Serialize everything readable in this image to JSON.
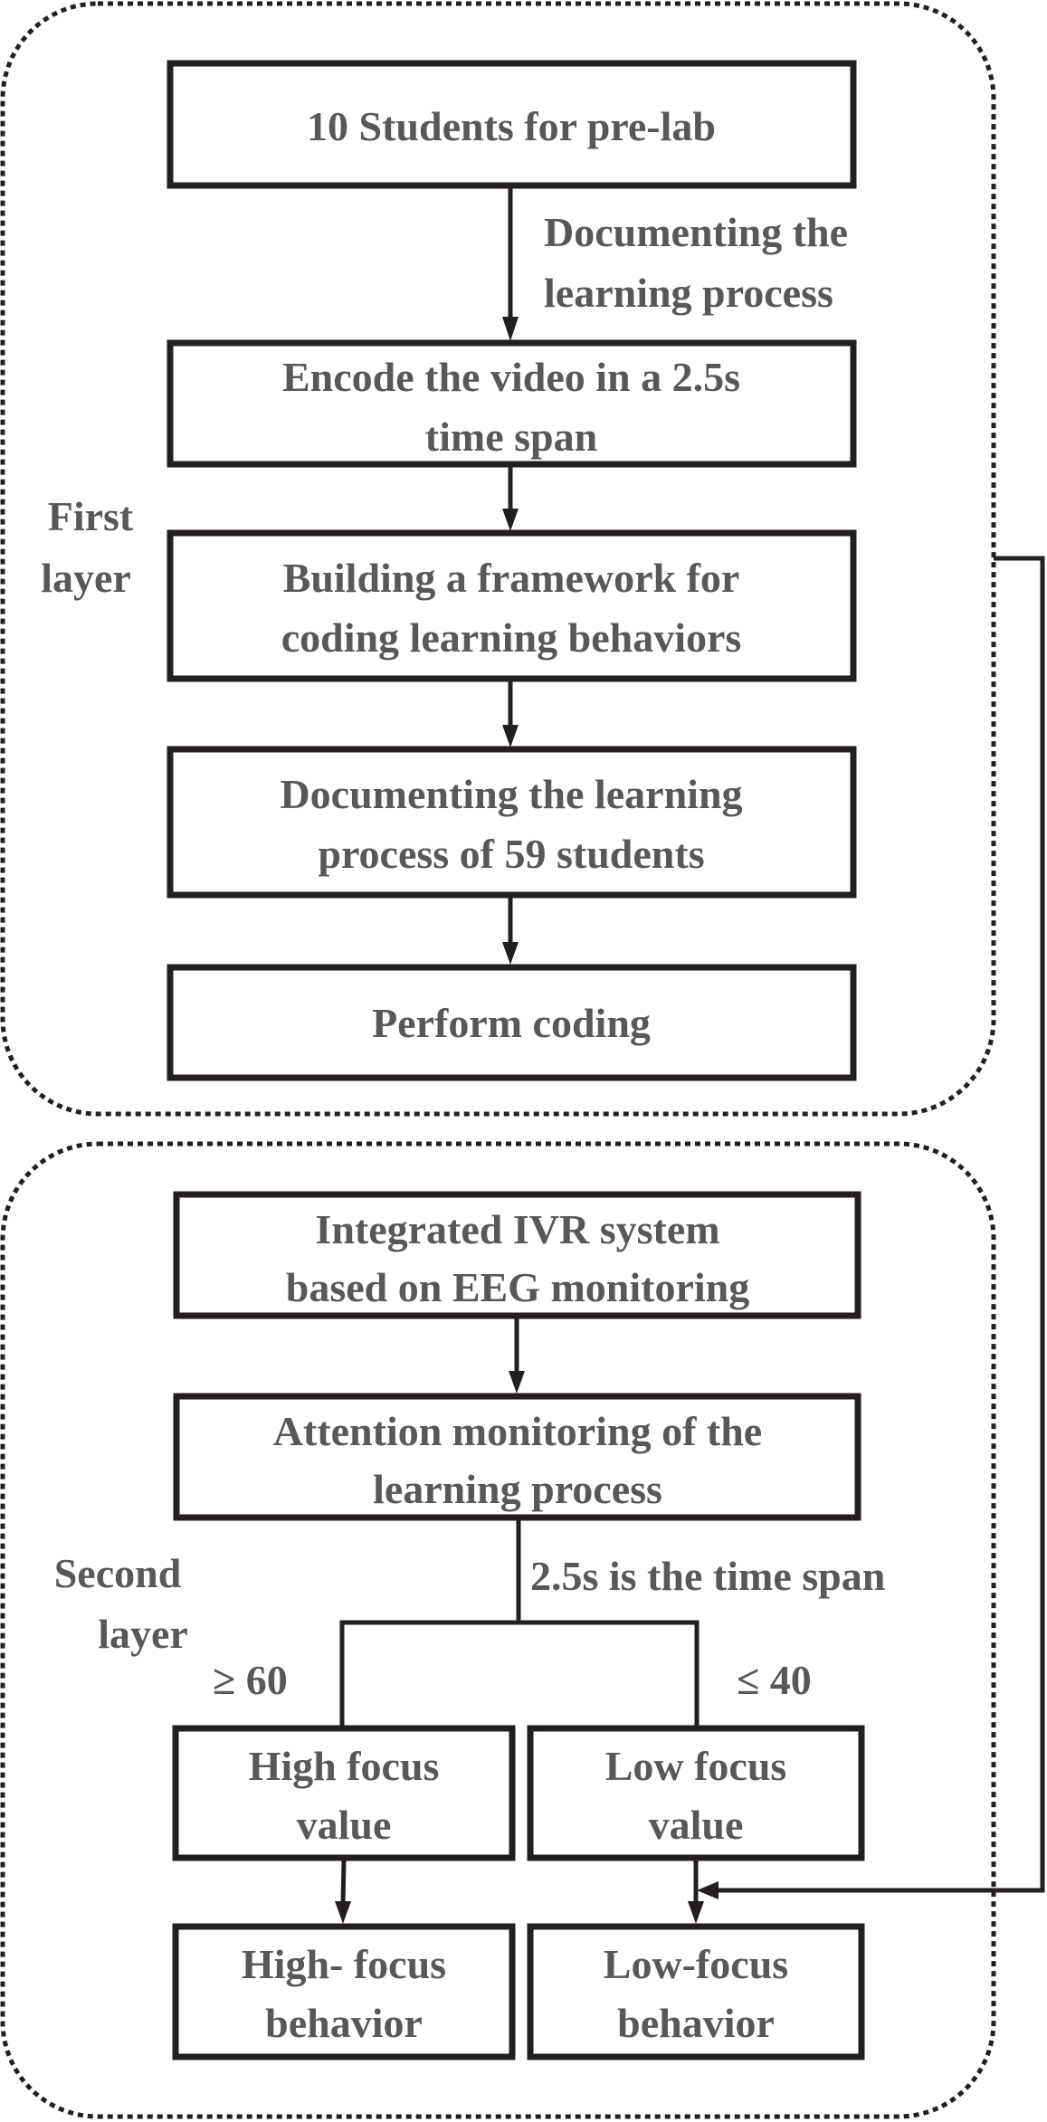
{
  "diagram": {
    "first_layer": {
      "label_line1": "First",
      "label_line2": "layer",
      "nodes": [
        {
          "id": "pre-lab",
          "lines": [
            "10 Students for pre-lab"
          ]
        },
        {
          "id": "encode",
          "lines": [
            "Encode the video in a 2.5s",
            "time span"
          ]
        },
        {
          "id": "framework",
          "lines": [
            "Building a framework for",
            "coding learning behaviors"
          ]
        },
        {
          "id": "documenting",
          "lines": [
            "Documenting the learning",
            "process of 59 students"
          ]
        },
        {
          "id": "perform-coding",
          "lines": [
            "Perform coding"
          ]
        }
      ],
      "edge_label_line1": "Documenting the",
      "edge_label_line2": "learning process"
    },
    "second_layer": {
      "label_line1": "Second",
      "label_line2": "layer",
      "nodes": [
        {
          "id": "ivr-system",
          "lines": [
            "Integrated IVR system",
            "based on EEG monitoring"
          ]
        },
        {
          "id": "attention-monitoring",
          "lines": [
            "Attention monitoring of the",
            "learning process"
          ]
        },
        {
          "id": "high-focus-value",
          "lines": [
            "High focus",
            "value"
          ]
        },
        {
          "id": "low-focus-value",
          "lines": [
            "Low focus",
            "value"
          ]
        },
        {
          "id": "high-focus-behavior",
          "lines": [
            "High- focus",
            "behavior"
          ]
        },
        {
          "id": "low-focus-behavior",
          "lines": [
            "Low-focus",
            "behavior"
          ]
        }
      ],
      "time_span_label": "2.5s is the time span",
      "high_threshold": "≥ 60",
      "low_threshold": "≤ 40"
    },
    "colors": {
      "text": "#58585a",
      "lines": "#231f20"
    }
  }
}
